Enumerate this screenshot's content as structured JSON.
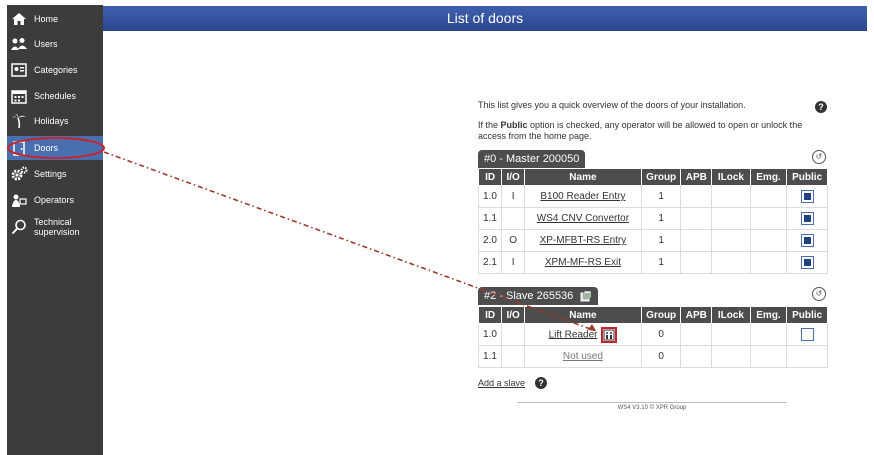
{
  "sidebar": {
    "items": [
      {
        "label": "Home",
        "icon": "home-icon"
      },
      {
        "label": "Users",
        "icon": "users-icon"
      },
      {
        "label": "Categories",
        "icon": "categories-icon"
      },
      {
        "label": "Schedules",
        "icon": "calendar-icon"
      },
      {
        "label": "Holidays",
        "icon": "palm-tree-icon"
      },
      {
        "label": "Doors",
        "icon": "door-icon"
      },
      {
        "label": "Settings",
        "icon": "gears-icon"
      },
      {
        "label": "Operators",
        "icon": "operator-icon"
      },
      {
        "label": "Technical",
        "label2": "supervision",
        "icon": "search-icon"
      }
    ]
  },
  "header": {
    "title": "List of doors"
  },
  "intro": {
    "line1": "This list gives you a quick overview of the doors of your installation.",
    "line2_pre": "If the ",
    "line2_bold": "Public",
    "line2_post": " option is checked, any operator will be allowed to open or unlock the access from the home page."
  },
  "master": {
    "tab_prefix": "#0 - ",
    "tab_name": "Master 200050",
    "columns": [
      "ID",
      "I/O",
      "Name",
      "Group",
      "APB",
      "ILock",
      "Emg.",
      "Public"
    ],
    "rows": [
      {
        "id": "1.0",
        "io": "I",
        "name": "B100 Reader Entry",
        "group": "1",
        "public": true
      },
      {
        "id": "1.1",
        "io": "",
        "name": "WS4 CNV Convertor",
        "group": "1",
        "public": true
      },
      {
        "id": "2.0",
        "io": "O",
        "name": "XP-MFBT-RS Entry",
        "group": "1",
        "public": true
      },
      {
        "id": "2.1",
        "io": "I",
        "name": "XPM-MF-RS Exit",
        "group": "1",
        "public": true
      }
    ]
  },
  "slave": {
    "tab_prefix": "#2 - ",
    "tab_name": "Slave 265536",
    "columns": [
      "ID",
      "I/O",
      "Name",
      "Group",
      "APB",
      "ILock",
      "Emg.",
      "Public"
    ],
    "rows": [
      {
        "id": "1.0",
        "io": "",
        "name": "Lift Reader",
        "group": "0",
        "public": false
      },
      {
        "id": "1.1",
        "io": "",
        "name": "Not used",
        "group": "0",
        "public": null
      }
    ]
  },
  "add_slave": "Add a slave",
  "footer": "WS4 V3.10 © XPR Group",
  "colors": {
    "accent": "#4a6fb0",
    "sidebar": "#3c3c3c",
    "annotation": "#c0262c"
  }
}
